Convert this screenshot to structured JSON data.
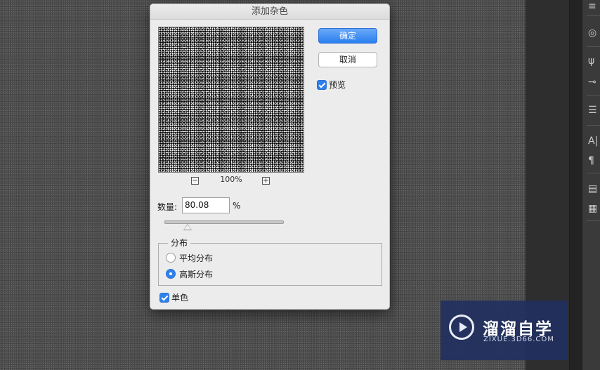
{
  "dialog": {
    "title": "添加杂色",
    "ok_label": "确定",
    "cancel_label": "取消",
    "preview_label": "预览",
    "preview_checked": true,
    "zoom": {
      "level": "100%",
      "minus_glyph": "−",
      "plus_glyph": "+"
    },
    "amount": {
      "label": "数量:",
      "value": "80.08",
      "unit": "%",
      "slider_fraction": 0.2
    },
    "distribution": {
      "title": "分布",
      "options": [
        {
          "label": "平均分布",
          "selected": false
        },
        {
          "label": "高斯分布",
          "selected": true
        }
      ]
    },
    "monochromatic": {
      "label": "单色",
      "checked": true
    }
  },
  "tools": {
    "icons": [
      "layers-icon",
      "brush-presets-icon",
      "adjustments-icon",
      "text-icon",
      "paragraph-icon",
      "notes-icon"
    ],
    "text_tool_glyph": "A|",
    "paragraph_glyph": "¶"
  },
  "watermark": {
    "title": "溜溜自学",
    "subtitle": "ZIXUE.3D66.COM"
  },
  "colors": {
    "accent": "#2f80ed",
    "canvas": "#4b4b4b",
    "dialog_bg": "#ececec"
  }
}
